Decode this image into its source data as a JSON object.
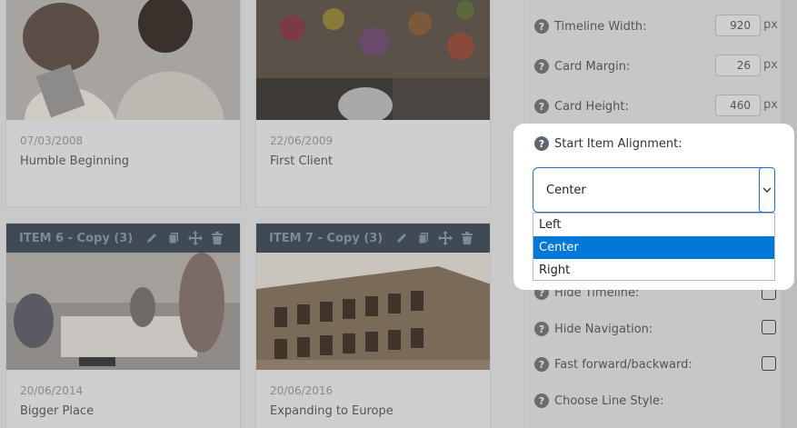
{
  "cards": [
    {
      "date": "07/03/2008",
      "title": "Humble Beginning"
    },
    {
      "date": "22/06/2009",
      "title": "First Client"
    },
    {
      "header": "ITEM 6 - Copy (3)",
      "date": "20/06/2014",
      "title": "Bigger Place"
    },
    {
      "header": "ITEM 7 - Copy (3)",
      "date": "20/06/2016",
      "title": "Expanding to Europe"
    }
  ],
  "card_tools": [
    "pencil-icon",
    "copy-icon",
    "move-icon",
    "trash-icon"
  ],
  "settings": {
    "timeline_width": {
      "label": "Timeline Width:",
      "value": "920",
      "unit": "px"
    },
    "card_margin": {
      "label": "Card Margin:",
      "value": "26",
      "unit": "px"
    },
    "card_height": {
      "label": "Card Height:",
      "value": "460",
      "unit": "px"
    },
    "hide_timeline": {
      "label": "Hide Timeline:"
    },
    "hide_navigation": {
      "label": "Hide Navigation:"
    },
    "fast_forward": {
      "label": "Fast forward/backward:"
    },
    "line_style": {
      "label": "Choose Line Style:"
    }
  },
  "help_icon_glyph": "?",
  "alignment": {
    "label": "Start Item Alignment:",
    "selected": "Center",
    "options": [
      "Left",
      "Center",
      "Right"
    ]
  },
  "colors": {
    "accent": "#0078d7",
    "header_bg": "#3f4a55"
  }
}
